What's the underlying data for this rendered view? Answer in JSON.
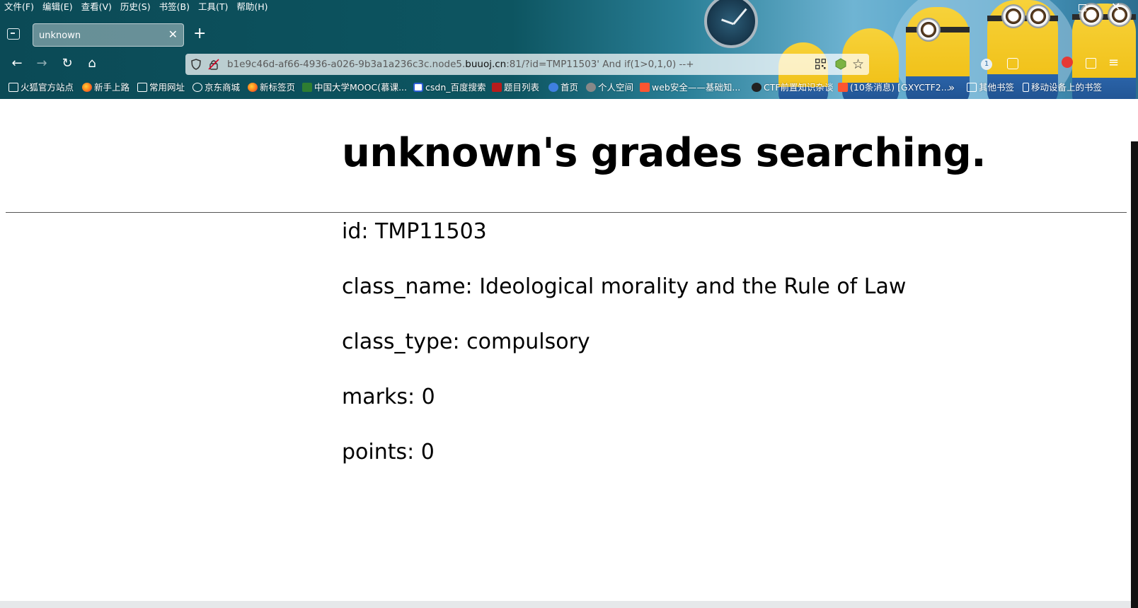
{
  "menubar": {
    "items": [
      "文件(F)",
      "编辑(E)",
      "查看(V)",
      "历史(S)",
      "书签(B)",
      "工具(T)",
      "帮助(H)"
    ]
  },
  "tabs": [
    {
      "title": "unknown",
      "active": true
    }
  ],
  "urlbar": {
    "url_prefix": "b1e9c46d-af66-4936-a026-9b3a1a236c3c.node5.",
    "url_host": "buuoj.cn",
    "url_suffix": ":81/?id=TMP11503' And if(1>0,1,0) --+"
  },
  "toolbar": {
    "badge_count": "1"
  },
  "bookmarks": [
    {
      "label": "火狐官方站点",
      "icon": "folder-icon"
    },
    {
      "label": "新手上路",
      "icon": "firefox-icon"
    },
    {
      "label": "常用网址",
      "icon": "folder-icon"
    },
    {
      "label": "京东商城",
      "icon": "globe-icon"
    },
    {
      "label": "新标签页",
      "icon": "firefox-icon"
    },
    {
      "label": "中国大学MOOC(慕课...",
      "icon": "mooc-icon"
    },
    {
      "label": "csdn_百度搜索",
      "icon": "baidu-icon"
    },
    {
      "label": "题目列表",
      "icon": "buuoj-icon"
    },
    {
      "label": "首页",
      "icon": "blue-globe-icon"
    },
    {
      "label": "个人空间",
      "icon": "gray-globe-icon"
    },
    {
      "label": "web安全——基础知...",
      "icon": "csdn-icon"
    },
    {
      "label": "CTF前置知识杂谈",
      "icon": "play-icon"
    },
    {
      "label": "(10条消息) [GXYCTF2...",
      "icon": "csdn-icon"
    },
    {
      "label": "其他书签",
      "icon": "folder-icon"
    },
    {
      "label": "移动设备上的书签",
      "icon": "mobile-icon"
    }
  ],
  "page": {
    "title": "unknown's grades searching.",
    "fields": [
      {
        "key": "id",
        "text": "id: TMP11503"
      },
      {
        "key": "class_name",
        "text": "class_name: Ideological morality and the Rule of Law"
      },
      {
        "key": "class_type",
        "text": "class_type: compulsory"
      },
      {
        "key": "marks",
        "text": "marks: 0"
      },
      {
        "key": "points",
        "text": "points: 0"
      }
    ]
  },
  "colors": {
    "chrome_base": "#0d5561",
    "page_bg": "#ffffff",
    "text": "#000000"
  }
}
